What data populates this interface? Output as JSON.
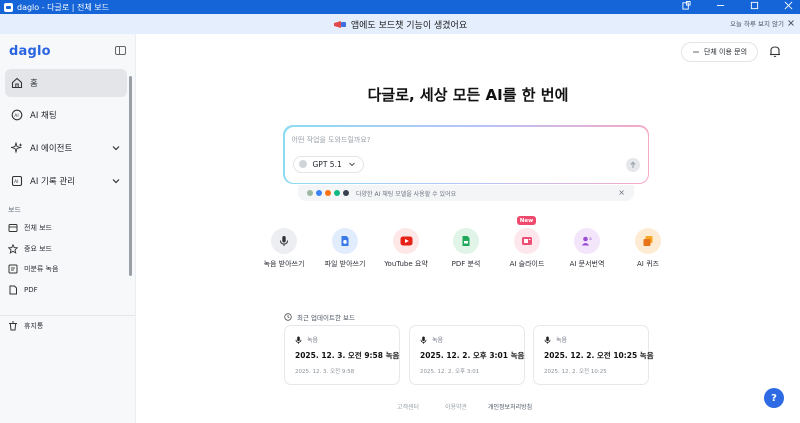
{
  "window": {
    "title": "daglo - 다글로 | 전체 보드"
  },
  "banner": {
    "text": "앱에도 보드챗 기능이 생겼어요",
    "dismiss_label": "오늘 하루 보지 않기"
  },
  "sidebar": {
    "logo": "daglo",
    "items": [
      {
        "label": "홈"
      },
      {
        "label": "AI 채팅"
      },
      {
        "label": "AI 에이전트"
      },
      {
        "label": "AI 기록 관리"
      }
    ],
    "section_label": "보드",
    "boards": [
      {
        "label": "전체 보드"
      },
      {
        "label": "중요 보드"
      },
      {
        "label": "미분류 녹음"
      },
      {
        "label": "PDF"
      }
    ],
    "trash_label": "휴지통"
  },
  "header": {
    "team_button": "단체 이용 문의"
  },
  "hero": {
    "title": "다글로, 세상 모든 AI를 한 번에"
  },
  "prompt": {
    "placeholder": "어떤 작업을 도와드릴까요?",
    "model": "GPT 5.1"
  },
  "hint": {
    "text": "다양한 AI 채팅 모델을 사용할 수 있어요"
  },
  "tools": [
    {
      "label": "녹음 받아쓰기"
    },
    {
      "label": "파일 받아쓰기"
    },
    {
      "label": "YouTube 요약"
    },
    {
      "label": "PDF 분석"
    },
    {
      "label": "AI 슬라이드",
      "badge": "New"
    },
    {
      "label": "AI 문서번역"
    },
    {
      "label": "AI 퀴즈"
    }
  ],
  "recent": {
    "title": "최근 업데이트한 보드",
    "cards": [
      {
        "type": "녹음",
        "title": "2025. 12. 3. 오전 9:58 녹음",
        "timestamp": "2025. 12. 3. 오전 9:58"
      },
      {
        "type": "녹음",
        "title": "2025. 12. 2. 오후 3:01 녹음",
        "timestamp": "2025. 12. 2. 오후 3:01"
      },
      {
        "type": "녹음",
        "title": "2025. 12. 2. 오전 10:25 녹음",
        "timestamp": "2025. 12. 2. 오전 10:25"
      }
    ]
  },
  "footer": {
    "links": [
      "고객센터",
      "이용약관",
      "개인정보처리방침"
    ]
  },
  "help": {
    "label": "?"
  },
  "colors": {
    "accent": "#2b64e0",
    "titlebar": "#1565d8",
    "banner_bg": "#e4eefc",
    "new_badge": "#ef4a6b"
  }
}
